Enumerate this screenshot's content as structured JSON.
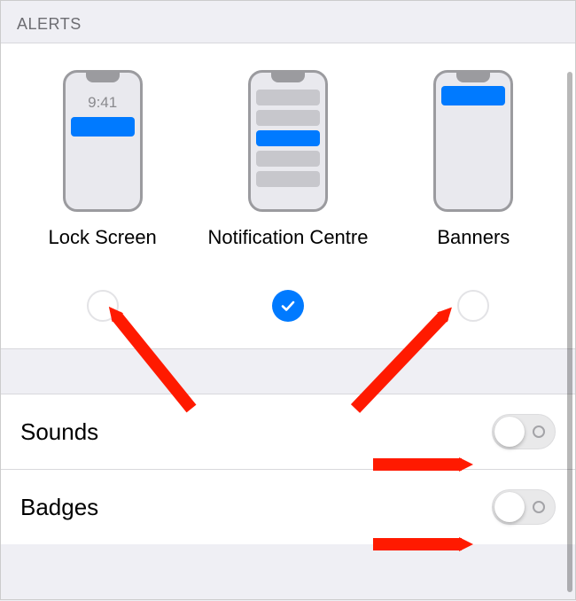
{
  "section_header": "ALERTS",
  "alert_options": {
    "lock_screen": {
      "label": "Lock Screen",
      "checked": false,
      "preview_time": "9:41"
    },
    "notification_centre": {
      "label": "Notification Centre",
      "checked": true
    },
    "banners": {
      "label": "Banners",
      "checked": false
    }
  },
  "rows": {
    "sounds": {
      "label": "Sounds",
      "on": false
    },
    "badges": {
      "label": "Badges",
      "on": false
    }
  },
  "colors": {
    "accent": "#007aff",
    "annotation": "#ff1a00"
  }
}
